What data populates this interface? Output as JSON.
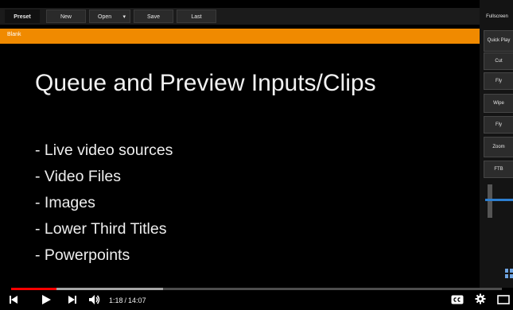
{
  "toolbar": {
    "preset_label": "Preset",
    "new_label": "New",
    "open_label": "Open",
    "open_dropdown": "▾",
    "save_label": "Save",
    "last_label": "Last"
  },
  "label_bar": {
    "text": "Blank"
  },
  "slide": {
    "title": "Queue and Preview Inputs/Clips",
    "bullets": [
      "- Live video sources",
      "- Video Files",
      "- Images",
      "- Lower Third Titles",
      "- Powerpoints"
    ]
  },
  "right_panel": {
    "fullscreen_label": "Fullscreen",
    "quick_label": "Quick Play",
    "transitions": [
      "Cut",
      "Fly",
      "Wipe",
      "Fly",
      "Zoom",
      "FTB"
    ]
  },
  "player": {
    "current_time": "1:18",
    "total_time": "14:07",
    "separator": "/",
    "played_fraction": 0.092,
    "loaded_fraction": 0.31
  },
  "colors": {
    "label_bar": "#f08a00",
    "progress_played": "#ff0000",
    "slider_handle": "#2d7fd0"
  }
}
